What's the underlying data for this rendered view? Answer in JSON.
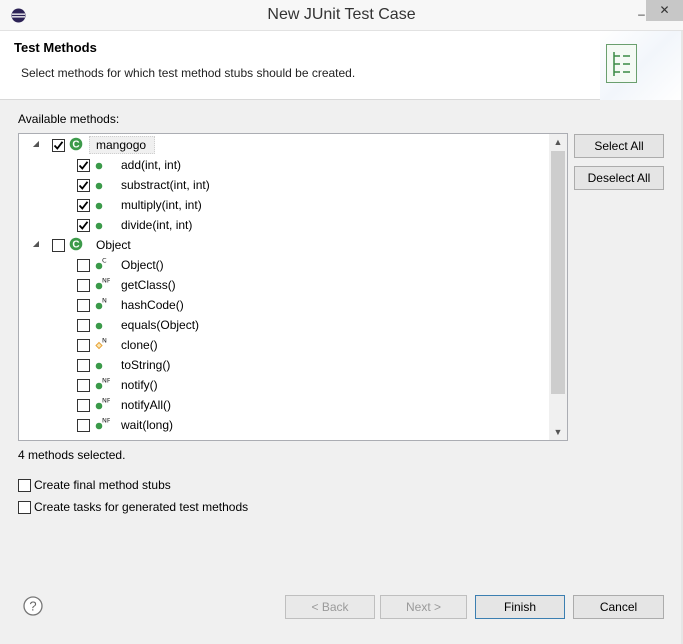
{
  "window": {
    "title": "New JUnit Test Case",
    "minimize_glyph": "–",
    "close_glyph": "✕"
  },
  "header": {
    "title": "Test Methods",
    "description": "Select methods for which test method stubs should be created."
  },
  "methods_panel": {
    "label": "Available methods:",
    "select_all": "Select All",
    "deselect_all": "Deselect All",
    "status": "4 methods selected.",
    "tree": [
      {
        "type": "class",
        "name": "mangogo",
        "checked": true,
        "expanded": true
      },
      {
        "type": "method",
        "name": "add(int, int)",
        "checked": true,
        "icon": "public-method-icon"
      },
      {
        "type": "method",
        "name": "substract(int, int)",
        "checked": true,
        "icon": "public-method-icon"
      },
      {
        "type": "method",
        "name": "multiply(int, int)",
        "checked": true,
        "icon": "public-method-icon"
      },
      {
        "type": "method",
        "name": "divide(int, int)",
        "checked": true,
        "icon": "public-method-icon"
      },
      {
        "type": "class",
        "name": "Object",
        "checked": false,
        "expanded": true
      },
      {
        "type": "method",
        "name": "Object()",
        "checked": false,
        "icon": "constructor-method-icon",
        "overlay": "C"
      },
      {
        "type": "method",
        "name": "getClass()",
        "checked": false,
        "icon": "native-final-method-icon",
        "overlay": "NF"
      },
      {
        "type": "method",
        "name": "hashCode()",
        "checked": false,
        "icon": "native-method-icon",
        "overlay": "N"
      },
      {
        "type": "method",
        "name": "equals(Object)",
        "checked": false,
        "icon": "public-method-icon"
      },
      {
        "type": "method",
        "name": "clone()",
        "checked": false,
        "icon": "protected-native-method-icon",
        "overlay": "N"
      },
      {
        "type": "method",
        "name": "toString()",
        "checked": false,
        "icon": "public-method-icon"
      },
      {
        "type": "method",
        "name": "notify()",
        "checked": false,
        "icon": "native-final-method-icon",
        "overlay": "NF"
      },
      {
        "type": "method",
        "name": "notifyAll()",
        "checked": false,
        "icon": "native-final-method-icon",
        "overlay": "NF"
      },
      {
        "type": "method",
        "name": "wait(long)",
        "checked": false,
        "icon": "native-final-method-icon",
        "overlay": "NF"
      }
    ]
  },
  "options": {
    "final_stubs": {
      "label": "Create final method stubs",
      "checked": false
    },
    "tasks": {
      "label": "Create tasks for generated test methods",
      "checked": false
    }
  },
  "footer": {
    "help_glyph": "?",
    "back": "< Back",
    "next": "Next >",
    "finish": "Finish",
    "cancel": "Cancel"
  },
  "colors": {
    "method_green": "#3a9a49",
    "class_green": "#3c9a4a",
    "protected_orange": "#e8a33a",
    "header_bg": "#ffffff",
    "dialog_bg": "#f0f0f0"
  }
}
